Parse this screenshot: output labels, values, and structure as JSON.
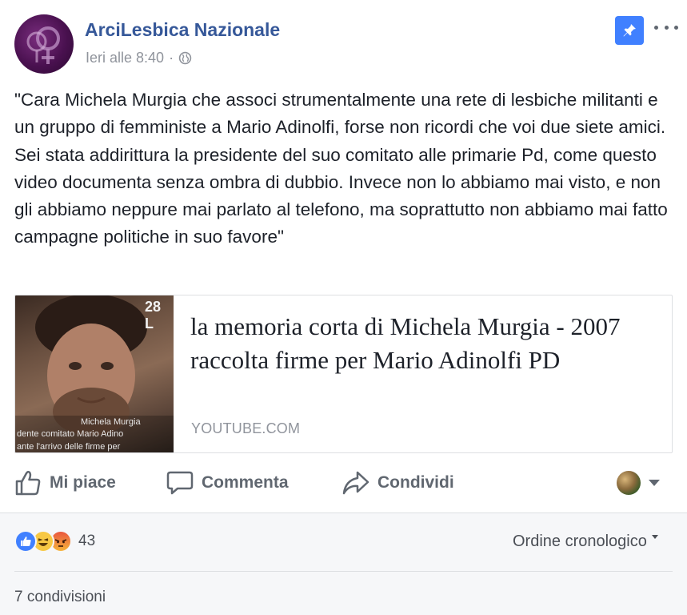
{
  "post": {
    "author": "ArciLesbica Nazionale",
    "timestamp": "Ieri alle 8:40",
    "separator": "·",
    "audience_icon": "globe-icon",
    "text": "\"Cara Michela Murgia che associ strumentalmente una rete di lesbiche militanti e un gruppo di femministe a Mario Adinolfi, forse non ricordi che voi due siete amici. Sei stata addirittura la presidente del suo comitato alle primarie Pd, come questo video documenta senza ombra di dubbio. Invece non lo abbiamo mai visto, e non gli abbiamo neppure mai parlato al telefono, ma soprattutto non abbiamo mai fatto campagne politiche in suo favore\""
  },
  "link": {
    "title": "la memoria corta di Michela Murgia - 2007 raccolta firme per Mario Adinolfi PD",
    "domain": "YOUTUBE.COM",
    "thumbnail_timestamp": "28 L",
    "thumbnail_caption_1": "Michela Murgia",
    "thumbnail_caption_2": "dente comitato Mario Adino",
    "thumbnail_caption_3": "ante l'arrivo delle firme per"
  },
  "actions": {
    "like": "Mi piace",
    "comment": "Commenta",
    "share": "Condividi"
  },
  "stats": {
    "reaction_count": "43",
    "reactions": [
      "like",
      "haha",
      "angry"
    ],
    "sort_label": "Ordine cronologico",
    "shares": "7 condivisioni"
  },
  "colors": {
    "brand_blue": "#365899",
    "pin_blue": "#4080ff",
    "muted_text": "#90949c"
  }
}
